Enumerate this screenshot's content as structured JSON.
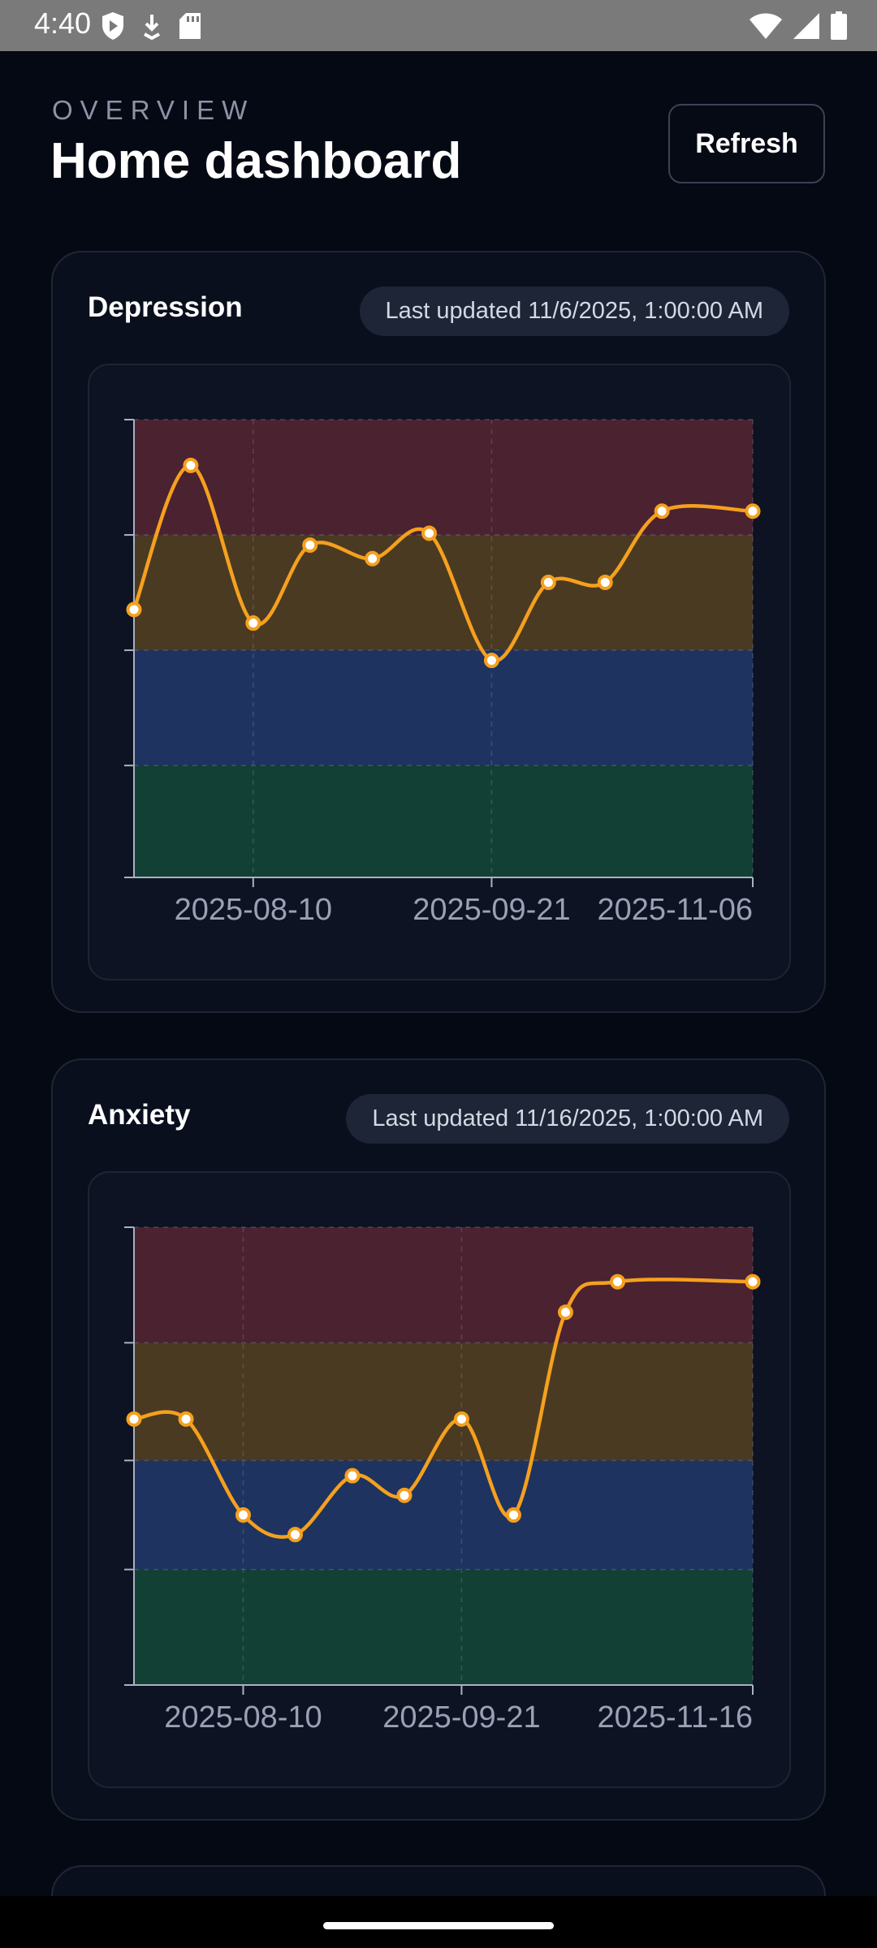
{
  "status_bar": {
    "time": "4:40",
    "left_icons": [
      "shield-icon",
      "download-icon",
      "sd-card-icon"
    ],
    "right_icons": [
      "wifi-icon",
      "cellular-signal-icon",
      "battery-icon"
    ]
  },
  "header": {
    "eyebrow": "OVERVIEW",
    "title": "Home dashboard",
    "refresh_label": "Refresh"
  },
  "colors": {
    "background": "#050914",
    "card": "#0a0f1d",
    "line": "#f5a01e",
    "band_severe": "#4a2230",
    "band_moderate": "#4a3a22",
    "band_mild": "#1e3360",
    "band_minimal": "#134034"
  },
  "cards": [
    {
      "title": "Depression",
      "updated": "Last updated 11/6/2025, 1:00:00 AM",
      "chart_data": {
        "type": "line",
        "x": [
          "2025-07-20",
          "2025-07-30",
          "2025-08-10",
          "2025-08-20",
          "2025-08-31",
          "2025-09-10",
          "2025-09-21",
          "2025-10-01",
          "2025-10-11",
          "2025-10-21",
          "2025-11-06"
        ],
        "values": [
          15.8,
          24.3,
          15,
          19.6,
          18.8,
          20.3,
          12.8,
          17.4,
          17.4,
          21.6,
          21.6
        ],
        "tick_labels": [
          "2025-08-10",
          "2025-09-21",
          "2025-11-06"
        ],
        "ylim": [
          0,
          27
        ],
        "bands": [
          {
            "from": 0,
            "to": 6.6,
            "color": "#134034"
          },
          {
            "from": 6.6,
            "to": 13.4,
            "color": "#1e3360"
          },
          {
            "from": 13.4,
            "to": 20.2,
            "color": "#4a3a22"
          },
          {
            "from": 20.2,
            "to": 27,
            "color": "#4a2230"
          }
        ],
        "grid": true
      }
    },
    {
      "title": "Anxiety",
      "updated": "Last updated 11/16/2025, 1:00:00 AM",
      "chart_data": {
        "type": "line",
        "x": [
          "2025-07-20",
          "2025-07-30",
          "2025-08-10",
          "2025-08-20",
          "2025-08-31",
          "2025-09-10",
          "2025-09-21",
          "2025-10-01",
          "2025-10-11",
          "2025-10-21",
          "2025-11-16"
        ],
        "values": [
          12.2,
          12.2,
          7.8,
          6.9,
          9.6,
          8.7,
          12.2,
          7.8,
          17.1,
          18.5,
          18.5
        ],
        "tick_labels": [
          "2025-08-10",
          "2025-09-21",
          "2025-11-16"
        ],
        "ylim": [
          0,
          21
        ],
        "bands": [
          {
            "from": 0,
            "to": 5.3,
            "color": "#134034"
          },
          {
            "from": 5.3,
            "to": 10.3,
            "color": "#1e3360"
          },
          {
            "from": 10.3,
            "to": 15.7,
            "color": "#4a3a22"
          },
          {
            "from": 15.7,
            "to": 21,
            "color": "#4a2230"
          }
        ],
        "grid": true
      }
    }
  ]
}
